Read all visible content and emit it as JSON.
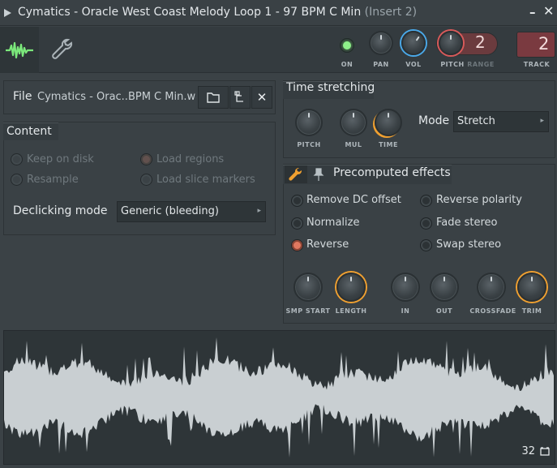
{
  "window": {
    "title": "Cymatics - Oracle West Coast Melody Loop 1 - 97 BPM C Min",
    "insert": "(Insert 2)"
  },
  "toolbar": {
    "on_label": "ON",
    "pan_label": "PAN",
    "vol_label": "VOL",
    "pitch_label": "PITCH",
    "range_label": "RANGE",
    "range_value": "2",
    "track_label": "TRACK",
    "track_value": "2"
  },
  "file": {
    "label": "File",
    "name": "Cymatics - Orac..BPM C Min.wav"
  },
  "content": {
    "title": "Content",
    "keep_on_disk": "Keep on disk",
    "resample": "Resample",
    "load_regions": "Load regions",
    "load_slice_markers": "Load slice markers",
    "declicking_label": "Declicking mode",
    "declicking_value": "Generic (bleeding)"
  },
  "time_stretching": {
    "title": "Time stretching",
    "pitch_label": "PITCH",
    "mul_label": "MUL",
    "time_label": "TIME",
    "mode_label": "Mode",
    "mode_value": "Stretch"
  },
  "precomputed": {
    "title": "Precomputed effects",
    "remove_dc": "Remove DC offset",
    "normalize": "Normalize",
    "reverse": "Reverse",
    "reverse_polarity": "Reverse polarity",
    "fade_stereo": "Fade stereo",
    "swap_stereo": "Swap stereo",
    "knobs": {
      "smp_start": "SMP START",
      "length": "LENGTH",
      "in": "IN",
      "out": "OUT",
      "crossfade": "CROSSFADE",
      "trim": "TRIM"
    }
  },
  "waveform": {
    "zoom_value": "32"
  },
  "colors": {
    "accent_orange": "#f0a030",
    "accent_blue": "#4aa8e8",
    "on_green": "#7be87b",
    "reverse_red": "#e07860",
    "waveform": "#c9cfd2"
  }
}
